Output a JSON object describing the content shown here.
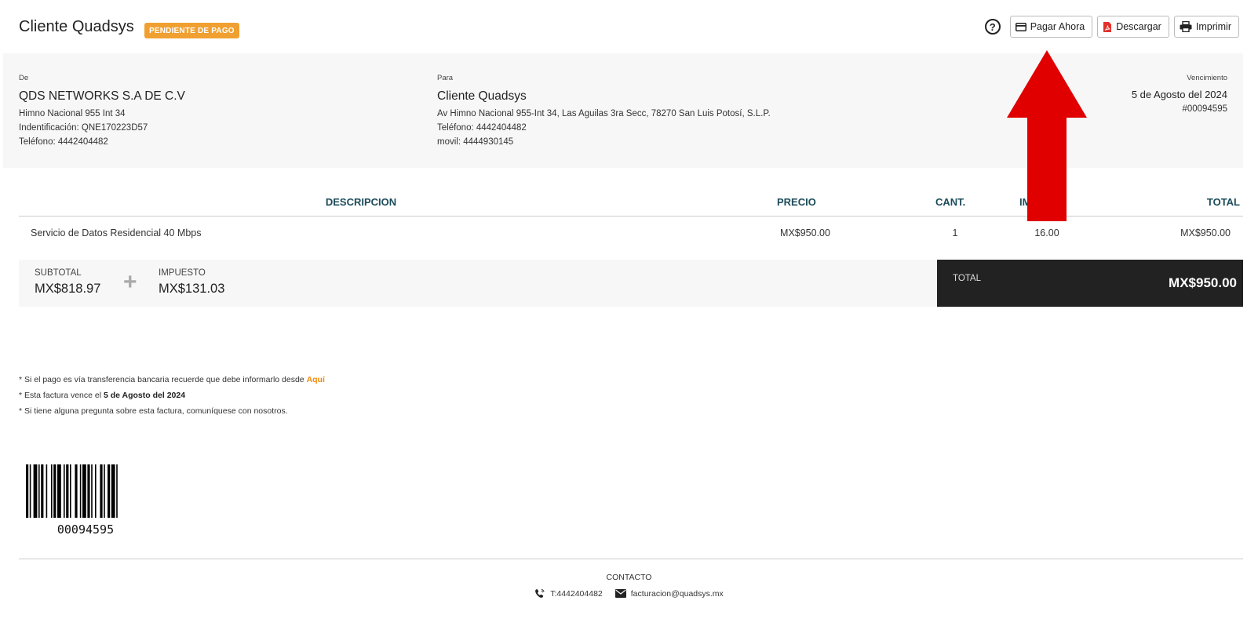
{
  "header": {
    "title": "Cliente Quadsys",
    "status": "PENDIENTE DE PAGO",
    "help_symbol": "?",
    "pay_label": "Pagar Ahora",
    "download_label": "Descargar",
    "print_label": "Imprimir"
  },
  "from": {
    "label": "De",
    "name": "QDS NETWORKS S.A DE C.V",
    "line1": "Himno Nacional 955 Int 34",
    "line2": "Indentificación: QNE170223D57",
    "line3": "Teléfono: 4442404482"
  },
  "to": {
    "label": "Para",
    "name": "Cliente Quadsys",
    "line1": "Av Himno Nacional 955-Int 34, Las Aguilas 3ra Secc, 78270 San Luis Potosí, S.L.P.",
    "line2": "Teléfono: 4442404482",
    "line3": "movil: 4444930145"
  },
  "due": {
    "label": "Vencimiento",
    "date": "5 de Agosto del 2024",
    "number": "#00094595"
  },
  "table": {
    "headers": {
      "desc": "DESCRIPCION",
      "precio": "PRECIO",
      "cant": "CANT.",
      "imp": "IM",
      "total": "TOTAL"
    },
    "rows": [
      {
        "desc": "Servicio de Datos Residencial 40 Mbps",
        "precio": "MX$950.00",
        "cant": "1",
        "imp": "16.00",
        "total": "MX$950.00"
      }
    ]
  },
  "totals": {
    "subtotal_label": "SUBTOTAL",
    "subtotal": "MX$818.97",
    "plus": "+",
    "tax_label": "IMPUESTO",
    "tax": "MX$131.03",
    "total_label": "TOTAL",
    "total": "MX$950.00"
  },
  "notes": {
    "n1": "* Si el pago es vía transferencia bancaria recuerde que debe informarlo desde ",
    "n1_link": "Aquí",
    "n2": "* Esta factura vence el ",
    "n2_date": "5 de Agosto del 2024",
    "n3": "* Si tiene alguna pregunta sobre esta factura, comuníquese con nosotros."
  },
  "barcode": {
    "number": "00094595"
  },
  "footer": {
    "title": "CONTACTO",
    "phone": "T:4442404482",
    "email": "facturacion@quadsys.mx"
  },
  "colors": {
    "badge": "#f0a030",
    "table_header": "#1b4b5a",
    "total_bg": "#222222",
    "link": "#f08a10",
    "arrow": "#e00000"
  },
  "icons": [
    "help-icon",
    "credit-card-icon",
    "pdf-file-icon",
    "printer-icon",
    "plus-icon",
    "phone-icon",
    "envelope-icon",
    "barcode",
    "red-arrow-annotation"
  ]
}
